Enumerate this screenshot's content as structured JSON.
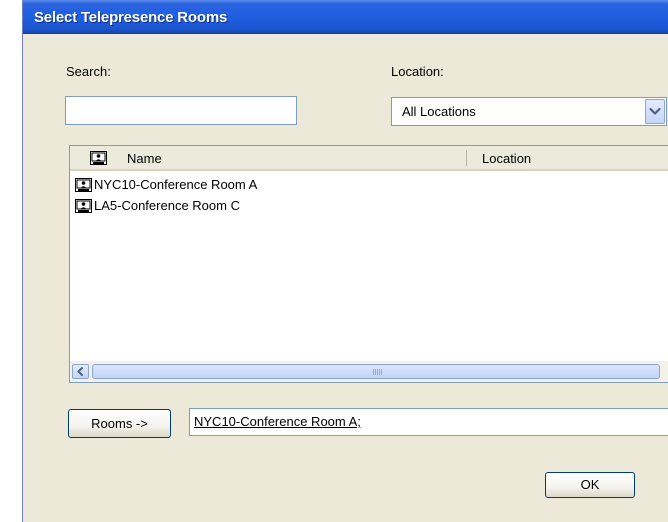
{
  "window": {
    "title": "Select Telepresence Rooms"
  },
  "search": {
    "label": "Search:",
    "value": ""
  },
  "location": {
    "label": "Location:",
    "selected": "All Locations"
  },
  "rooms_list": {
    "columns": [
      "Name",
      "Location"
    ],
    "rows": [
      {
        "name": "NYC10-Conference Room A",
        "location": ""
      },
      {
        "name": "LA5-Conference Room C",
        "location": ""
      }
    ],
    "icon": "telepresence-room-icon"
  },
  "rooms_button": {
    "label": "Rooms ->"
  },
  "selected_rooms": {
    "value": "NYC10-Conference Room A;"
  },
  "ok_button": {
    "label": "OK"
  },
  "colors": {
    "titlebar": "#1f5fe0",
    "dialog_background": "#ece9d8",
    "field_border": "#7f9db9"
  }
}
